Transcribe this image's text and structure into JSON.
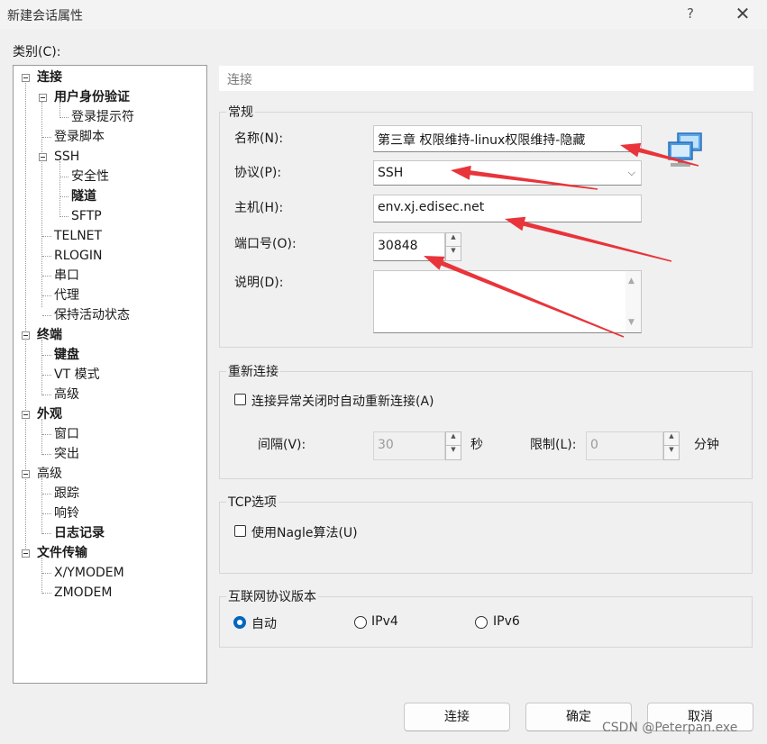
{
  "window": {
    "title": "新建会话属性",
    "help": "?",
    "close": "✕"
  },
  "category_label": "类别(C):",
  "tree": [
    {
      "label": "连接",
      "bold": true
    },
    {
      "label": "用户身份验证",
      "bold": true
    },
    {
      "label": "登录提示符",
      "bold": false
    },
    {
      "label": "登录脚本",
      "bold": false
    },
    {
      "label": "SSH",
      "bold": false
    },
    {
      "label": "安全性",
      "bold": false
    },
    {
      "label": "隧道",
      "bold": true
    },
    {
      "label": "SFTP",
      "bold": false
    },
    {
      "label": "TELNET",
      "bold": false
    },
    {
      "label": "RLOGIN",
      "bold": false
    },
    {
      "label": "串口",
      "bold": false
    },
    {
      "label": "代理",
      "bold": false
    },
    {
      "label": "保持活动状态",
      "bold": false
    },
    {
      "label": "终端",
      "bold": true
    },
    {
      "label": "键盘",
      "bold": true
    },
    {
      "label": "VT 模式",
      "bold": false
    },
    {
      "label": "高级",
      "bold": false
    },
    {
      "label": "外观",
      "bold": true
    },
    {
      "label": "窗口",
      "bold": false
    },
    {
      "label": "突出",
      "bold": false
    },
    {
      "label": "高级",
      "bold": false
    },
    {
      "label": "跟踪",
      "bold": false
    },
    {
      "label": "响铃",
      "bold": false
    },
    {
      "label": "日志记录",
      "bold": true
    },
    {
      "label": "文件传输",
      "bold": true
    },
    {
      "label": "X/YMODEM",
      "bold": false
    },
    {
      "label": "ZMODEM",
      "bold": false
    }
  ],
  "section_header": "连接",
  "general": {
    "title": "常规",
    "name_label": "名称(N):",
    "name_value": "第三章 权限维持-linux权限维持-隐藏",
    "protocol_label": "协议(P):",
    "protocol_value": "SSH",
    "host_label": "主机(H):",
    "host_value": "env.xj.edisec.net",
    "port_label": "端口号(O):",
    "port_value": "30848",
    "desc_label": "说明(D):",
    "desc_value": ""
  },
  "reconnect": {
    "title": "重新连接",
    "checkbox_label": "连接异常关闭时自动重新连接(A)",
    "interval_label": "间隔(V):",
    "interval_value": "30",
    "interval_unit": "秒",
    "limit_label": "限制(L):",
    "limit_value": "0",
    "limit_unit": "分钟"
  },
  "tcp": {
    "title": "TCP选项",
    "nagle_label": "使用Nagle算法(U)"
  },
  "ip_version": {
    "title": "互联网协议版本",
    "options": [
      "自动",
      "IPv4",
      "IPv6"
    ],
    "selected": "自动"
  },
  "buttons": {
    "connect": "连接",
    "ok": "确定",
    "cancel": "取消"
  },
  "watermark": "CSDN @Peterpan.exe",
  "colors": {
    "arrow": "#e8343a",
    "accent": "#0067c0"
  }
}
